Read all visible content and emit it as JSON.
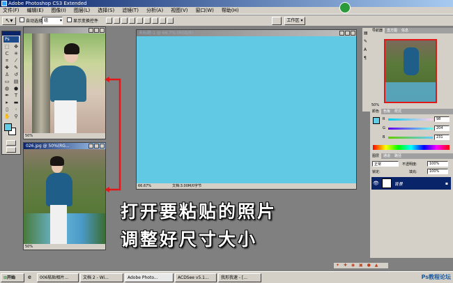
{
  "app": {
    "title": "Adobe Photoshop CS3 Extended",
    "logo_text": "Ps"
  },
  "menu": [
    "文件(F)",
    "编辑(E)",
    "图像(I)",
    "图层(L)",
    "选择(S)",
    "滤镜(T)",
    "分析(A)",
    "视图(V)",
    "窗口(W)",
    "帮助(H)"
  ],
  "options": {
    "auto_select": "自动选择:",
    "auto_select_value": "组",
    "show_transform": "显示变换控件",
    "workspace": "工作区 ▾"
  },
  "doc1": {
    "title": ""
  },
  "doc2": {
    "title": "026.jpg @ 50%(RG...",
    "status": "50%"
  },
  "doc3": {
    "title": "未标题-1 @ 66.7% (RGB/8)",
    "zoom": "66.67%",
    "status": "文档:3.00M/0字节"
  },
  "navigator": {
    "tabs": [
      "导航器",
      "直方图",
      "信息"
    ],
    "zoom": "50%"
  },
  "color": {
    "tabs": [
      "颜色",
      "色板",
      "样式"
    ],
    "r_label": "R",
    "r_value": "98",
    "g_label": "G",
    "g_value": "204",
    "b_label": "B",
    "b_value": "231",
    "fg_color": "#62cce7"
  },
  "layers": {
    "tabs": [
      "图层",
      "通道",
      "路径"
    ],
    "mode": "正常",
    "opacity_label": "不透明度:",
    "opacity": "100%",
    "lock_label": "锁定:",
    "fill_label": "填充:",
    "fill": "100%",
    "layer_name": "背景"
  },
  "captions": {
    "line1": "打开要粘贴的照片",
    "line2": "调整好尺寸大小"
  },
  "taskbar": {
    "start": "开始",
    "items": [
      "006粘贴相片...",
      "文档 2 - Wi...",
      "Adobe Photo...",
      "ACDSee v5.1...",
      "我形我速 - [..."
    ],
    "watermark": "Ps教程论坛"
  },
  "canvas_color": "#62c9e4"
}
